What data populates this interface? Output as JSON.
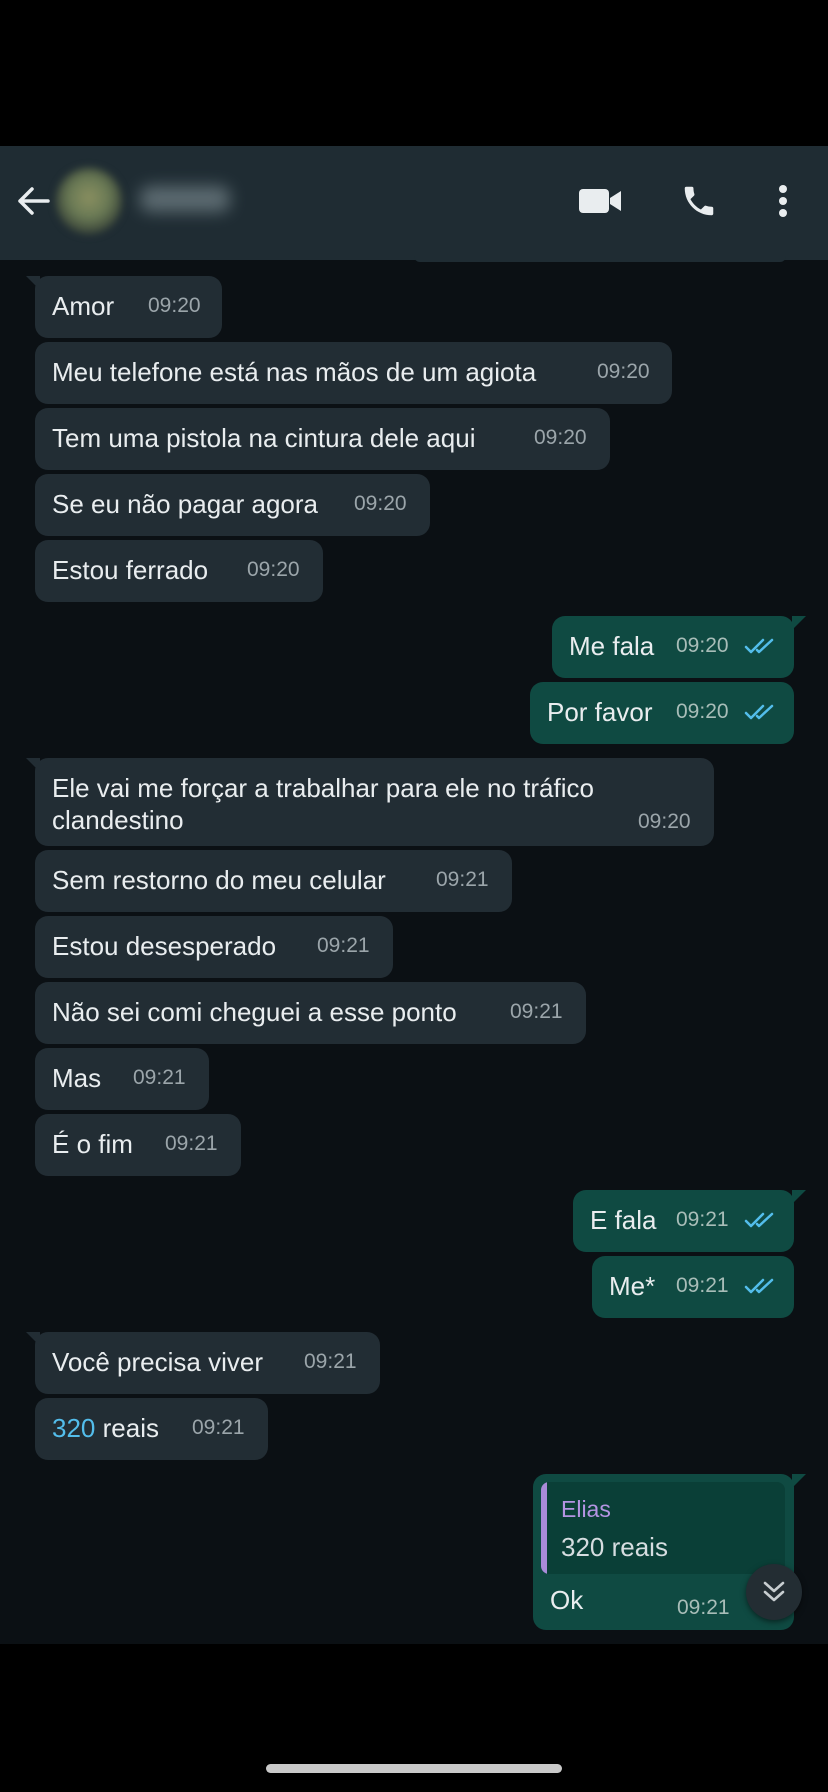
{
  "header": {
    "contact_name": "Elias",
    "icons": [
      "back-arrow-icon",
      "video-call-icon",
      "voice-call-icon",
      "more-options-icon"
    ]
  },
  "messages": [
    {
      "text": "Amor",
      "time": "09:20",
      "dir": "in"
    },
    {
      "text": "Meu telefone está nas mãos de um agiota",
      "time": "09:20",
      "dir": "in"
    },
    {
      "text": "Tem uma pistola na cintura dele aqui",
      "time": "09:20",
      "dir": "in"
    },
    {
      "text": "Se eu não pagar agora",
      "time": "09:20",
      "dir": "in"
    },
    {
      "text": "Estou ferrado",
      "time": "09:20",
      "dir": "in"
    },
    {
      "text": "Me fala",
      "time": "09:20",
      "dir": "out",
      "status": "read"
    },
    {
      "text": "Por favor",
      "time": "09:20",
      "dir": "out",
      "status": "read"
    },
    {
      "text": "Ele vai me forçar a trabalhar para ele no tráfico clandestino",
      "time": "09:20",
      "dir": "in"
    },
    {
      "text": "Sem restorno do meu celular",
      "time": "09:21",
      "dir": "in"
    },
    {
      "text": "Estou desesperado",
      "time": "09:21",
      "dir": "in"
    },
    {
      "text": "Não sei comi cheguei a esse ponto",
      "time": "09:21",
      "dir": "in"
    },
    {
      "text": "Mas",
      "time": "09:21",
      "dir": "in"
    },
    {
      "text": "É o fim",
      "time": "09:21",
      "dir": "in"
    },
    {
      "text": "E fala",
      "time": "09:21",
      "dir": "out",
      "status": "read"
    },
    {
      "text": "Me*",
      "time": "09:21",
      "dir": "out",
      "status": "read"
    },
    {
      "text": "Você precisa viver",
      "time": "09:21",
      "dir": "in"
    },
    {
      "text": "320 reais",
      "time": "09:21",
      "dir": "in",
      "number": "320",
      "rest": " reais"
    },
    {
      "text": "Ok",
      "time": "09:21",
      "dir": "out",
      "quote": {
        "author": "Elias",
        "text": "320 reais"
      }
    }
  ],
  "colors": {
    "incoming_bubble": "#222d34",
    "outgoing_bubble": "#005c4b",
    "header": "#1f2c33",
    "read_ticks": "#53bdeb",
    "link_number": "#53bdeb",
    "quote_author": "#b494e3"
  }
}
